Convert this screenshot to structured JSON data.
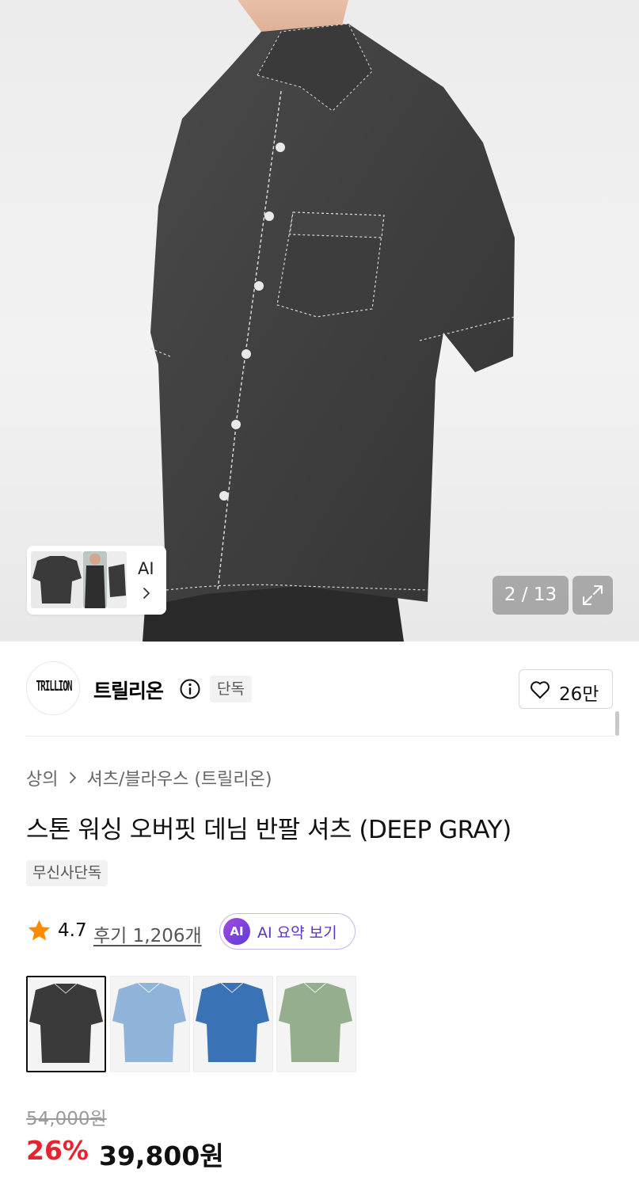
{
  "gallery": {
    "counter": "2 / 13",
    "ai_label": "AI"
  },
  "brand": {
    "logo_text": "TRILLION",
    "name": "트릴리온",
    "exclusive_badge": "단독",
    "like_count": "26만"
  },
  "product": {
    "breadcrumb": [
      "상의",
      "셔츠/블라우스 (트릴리온)"
    ],
    "title": "스톤 워싱 오버핏 데님 반팔 셔츠 (DEEP GRAY)",
    "tag": "무신사단독",
    "rating": "4.7",
    "reviews_label": "후기 1,206개",
    "ai_summary_badge": "AI",
    "ai_summary_label": "AI 요약 보기"
  },
  "colors": [
    {
      "name": "deep-gray",
      "hex": "#3a3a3a",
      "selected": true
    },
    {
      "name": "light-blue",
      "hex": "#8fb3d9",
      "selected": false
    },
    {
      "name": "blue",
      "hex": "#3a73b5",
      "selected": false
    },
    {
      "name": "sage-green",
      "hex": "#95ae8d",
      "selected": false
    }
  ],
  "price": {
    "original": "54,000원",
    "discount": "26%",
    "final": "39,800원"
  },
  "theme": {
    "discount_color": "#e8232f",
    "ai_accent": "#5b32c6",
    "star_color": "#ff8a00"
  }
}
